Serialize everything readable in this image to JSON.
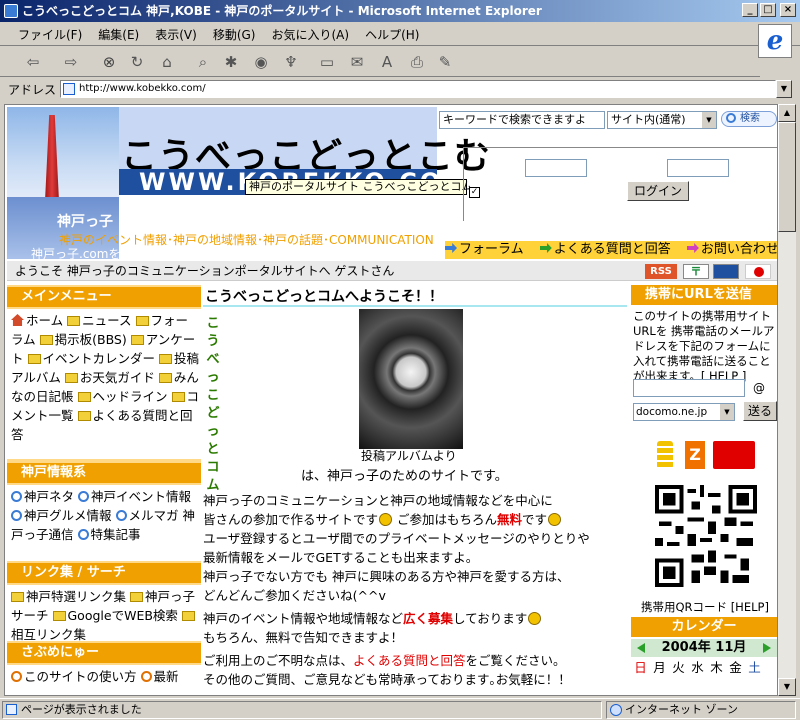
{
  "window": {
    "title": "こうべっこどっとコム 神戸,KOBE - 神戸のポータルサイト - Microsoft Internet Explorer",
    "minimize": "_",
    "maximize": "□",
    "close": "×"
  },
  "menu": [
    "ファイル(F)",
    "編集(E)",
    "表示(V)",
    "移動(G)",
    "お気に入り(A)",
    "ヘルプ(H)"
  ],
  "address": {
    "label": "アドレス",
    "url": "http://www.kobekko.com/"
  },
  "status": {
    "message": "ページが表示されました",
    "zone": "インターネット ゾーン"
  },
  "header": {
    "title": "こうべっこどっとこむ",
    "url_strip": "WWW.KOBEKKO.COM",
    "tooltip": "神戸のポータルサイト こうべっこどっとコム",
    "kobekko_label": "神戸っ子",
    "tagline": "神戸のイベント情報･神戸の地域情報･神戸の話題･COMMUNICATION",
    "kobekko_com": "神戸っ子.comを"
  },
  "search": {
    "placeholder": "キーワードで検索できますよ",
    "scope": "サイト内(通常)",
    "button": "検索"
  },
  "login": {
    "button": "ログイン"
  },
  "nav": {
    "forum": "フォーラム",
    "faq": "よくある質問と回答",
    "contact": "お問い合わせ"
  },
  "welcome": {
    "text": "ようこそ 神戸っ子のコミュニケーションポータルサイトへ ゲストさん",
    "rss": "RSS"
  },
  "left": {
    "main_menu": {
      "heading": "メインメニュー",
      "items": [
        "ホーム",
        "ニュース",
        "フォーラム",
        "掲示板(BBS)",
        "アンケート",
        "イベントカレンダー",
        "投稿アルバム",
        "お天気ガイド",
        "みんなの日記帳",
        "ヘッドライン",
        "コメント一覧",
        "よくある質問と回答"
      ]
    },
    "kobe_info": {
      "heading": "神戸情報系",
      "items": [
        "神戸ネタ",
        "神戸イベント情報",
        "神戸グルメ情報",
        "メルマガ 神戸っ子通信",
        "特集記事"
      ]
    },
    "links": {
      "heading": "リンク集 / サーチ",
      "items": [
        "神戸特選リンク集",
        "神戸っ子サーチ",
        "GoogleでWEB検索",
        "相互リンク集"
      ]
    },
    "sabu": {
      "heading": "さぶめにゅー",
      "items": [
        "このサイトの使い方",
        "最新"
      ]
    }
  },
  "center": {
    "title": "こうべっこどっとコムへようこそ！！",
    "vertical": [
      "こ",
      "う",
      "べ",
      "っ",
      "こ",
      "ど",
      "っ",
      "と",
      "コ",
      "ム"
    ],
    "photo_caption": "投稿アルバムより",
    "photo_caption2": "は、神戸っ子のためのサイトです。",
    "p1a": "神戸っ子のコミュニケーションと神戸の地域情報などを中心に",
    "p1b": "皆さんの参加で作るサイトです",
    "p1c": " ご参加はもちろん",
    "free": "無料",
    "p1d": "です",
    "p1e": "ユーザ登録するとユーザ間でのプライベートメッセージのやりとりや",
    "p1f": "最新情報をメールでGETすることも出来ますよ。",
    "p2a": "神戸っ子でない方でも 神戸に興味のある方や神戸を愛する方は、",
    "p2b": "どんどんご参加くださいね(^^v",
    "p3a": "神戸のイベント情報や地域情報など",
    "recruit": "広く募集",
    "p3b": "しております",
    "p3c": "もちろん、無料で告知できますよ！",
    "p4a": "ご利用上のご不明な点は、",
    "faq_link": "よくある質問と回答",
    "p4b": "をご覧ください。",
    "p5": "その他のご質問、ご意見なども常時承っております｡お気軽に！！"
  },
  "right": {
    "heading": "携帯にURLを送信",
    "desc": "このサイトの携帯用サイトURLを 携帯電話のメールアドレスを下記のフォームに入れて携帯電話に送ることが出来ます。[ HELP ]",
    "at": "@",
    "carrier": "docomo.ne.jp",
    "send": "送る",
    "qr_caption": "携帯用QRコード [HELP]",
    "calendar_heading": "カレンダー",
    "calendar_month": "2004年 11月",
    "weekdays": [
      "日",
      "月",
      "火",
      "水",
      "木",
      "金",
      "土"
    ]
  },
  "colors": {
    "accent": "#f0a000",
    "sidebar_bg": "#ffd987",
    "nav_bg": "#ffd23a",
    "link_red": "#e00000"
  }
}
